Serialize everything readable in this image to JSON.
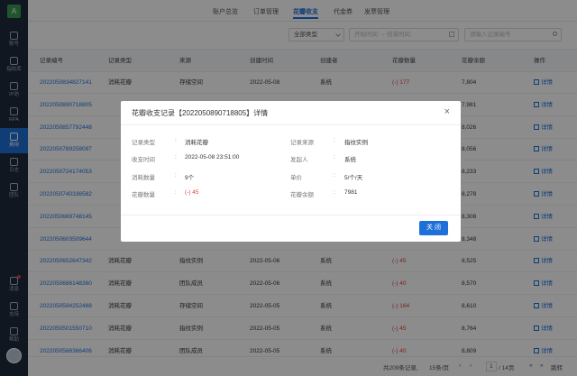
{
  "sidebar": {
    "logo": "A",
    "items": [
      {
        "label": "账号",
        "active": false
      },
      {
        "label": "指纹库",
        "active": false
      },
      {
        "label": "IP池",
        "active": false
      },
      {
        "label": "RPA",
        "active": false
      },
      {
        "label": "费用",
        "active": true
      },
      {
        "label": "日志",
        "active": false
      },
      {
        "label": "团队",
        "active": false
      }
    ],
    "bottom": [
      {
        "label": "消息"
      },
      {
        "label": "支持"
      },
      {
        "label": "帮助"
      }
    ]
  },
  "tabs": [
    {
      "label": "账户总览",
      "active": false
    },
    {
      "label": "订单管理",
      "active": false
    },
    {
      "label": "花瓣收支",
      "active": true
    },
    {
      "label": "代金券",
      "active": false
    },
    {
      "label": "发票管理",
      "active": false
    }
  ],
  "filters": {
    "type_select": "全部类型",
    "date_start": "开始时间",
    "date_sep": "→",
    "date_end": "结束时间",
    "search_placeholder": "请输入记录编号"
  },
  "table": {
    "headers": [
      "记录编号",
      "记录类型",
      "来源",
      "创建时间",
      "创建者",
      "花瓣数量",
      "花瓣余额",
      "操作"
    ],
    "rows": [
      {
        "id": "2022050834827141",
        "type": "消耗花瓣",
        "source": "存储空间",
        "time": "2022-05-08",
        "creator": "系统",
        "amount": "(-) 177",
        "balance": "7,804",
        "action": "详情"
      },
      {
        "id": "2022050890718805",
        "type": "",
        "source": "",
        "time": "",
        "creator": "",
        "amount": "",
        "balance": "7,981",
        "action": "详情"
      },
      {
        "id": "2022050857792448",
        "type": "",
        "source": "",
        "time": "",
        "creator": "",
        "amount": "",
        "balance": "8,026",
        "action": "详情"
      },
      {
        "id": "2022050789258097",
        "type": "",
        "source": "",
        "time": "",
        "creator": "",
        "amount": "",
        "balance": "8,056",
        "action": "详情"
      },
      {
        "id": "2022050724174053",
        "type": "",
        "source": "",
        "time": "",
        "creator": "",
        "amount": "",
        "balance": "8,233",
        "action": "详情"
      },
      {
        "id": "2022050740336582",
        "type": "",
        "source": "",
        "time": "",
        "creator": "",
        "amount": "",
        "balance": "8,278",
        "action": "详情"
      },
      {
        "id": "2022050669748145",
        "type": "",
        "source": "",
        "time": "",
        "creator": "",
        "amount": "",
        "balance": "8,308",
        "action": "详情"
      },
      {
        "id": "2022050603509644",
        "type": "",
        "source": "",
        "time": "",
        "creator": "",
        "amount": "",
        "balance": "8,348",
        "action": "详情"
      },
      {
        "id": "2022050652647342",
        "type": "消耗花瓣",
        "source": "指纹实例",
        "time": "2022-05-06",
        "creator": "系统",
        "amount": "(-) 45",
        "balance": "8,525",
        "action": "详情"
      },
      {
        "id": "2022050686148360",
        "type": "消耗花瓣",
        "source": "团队成员",
        "time": "2022-05-06",
        "creator": "系统",
        "amount": "(-) 40",
        "balance": "8,570",
        "action": "详情"
      },
      {
        "id": "2022050594252488",
        "type": "消耗花瓣",
        "source": "存储空间",
        "time": "2022-05-05",
        "creator": "系统",
        "amount": "(-) 164",
        "balance": "8,610",
        "action": "详情"
      },
      {
        "id": "2022050501550710",
        "type": "消耗花瓣",
        "source": "指纹实例",
        "time": "2022-05-05",
        "creator": "系统",
        "amount": "(-) 45",
        "balance": "8,764",
        "action": "详情"
      },
      {
        "id": "2022050568366406",
        "type": "消耗花瓣",
        "source": "团队成员",
        "time": "2022-05-05",
        "creator": "系统",
        "amount": "(-) 40",
        "balance": "8,809",
        "action": "详情"
      }
    ]
  },
  "pagination": {
    "total": "共209条记录,",
    "per_page": "15条/页",
    "current": "1",
    "pages": "/ 14页",
    "jump": "跳转"
  },
  "modal": {
    "title": "花瓣收支记录【2022050890718805】详情",
    "close_icon": "×",
    "fields_left": [
      {
        "label": "记录类型",
        "value": "消耗花瓣"
      },
      {
        "label": "收支时间",
        "value": "2022-05-08 23:51:00"
      },
      {
        "label": "消耗数量",
        "value": "9个"
      },
      {
        "label": "花瓣数量",
        "value": "(-) 45"
      }
    ],
    "fields_right": [
      {
        "label": "记录来源",
        "value": "指纹实例"
      },
      {
        "label": "发起人",
        "value": "系统"
      },
      {
        "label": "单价",
        "value": "5/个/天"
      },
      {
        "label": "花瓣余额",
        "value": "7981"
      }
    ],
    "close_button": "关 闭"
  },
  "colors": {
    "accent": "#1f6fd8",
    "sidebar": "#1e2a3b",
    "negative": "#e03c3c"
  }
}
